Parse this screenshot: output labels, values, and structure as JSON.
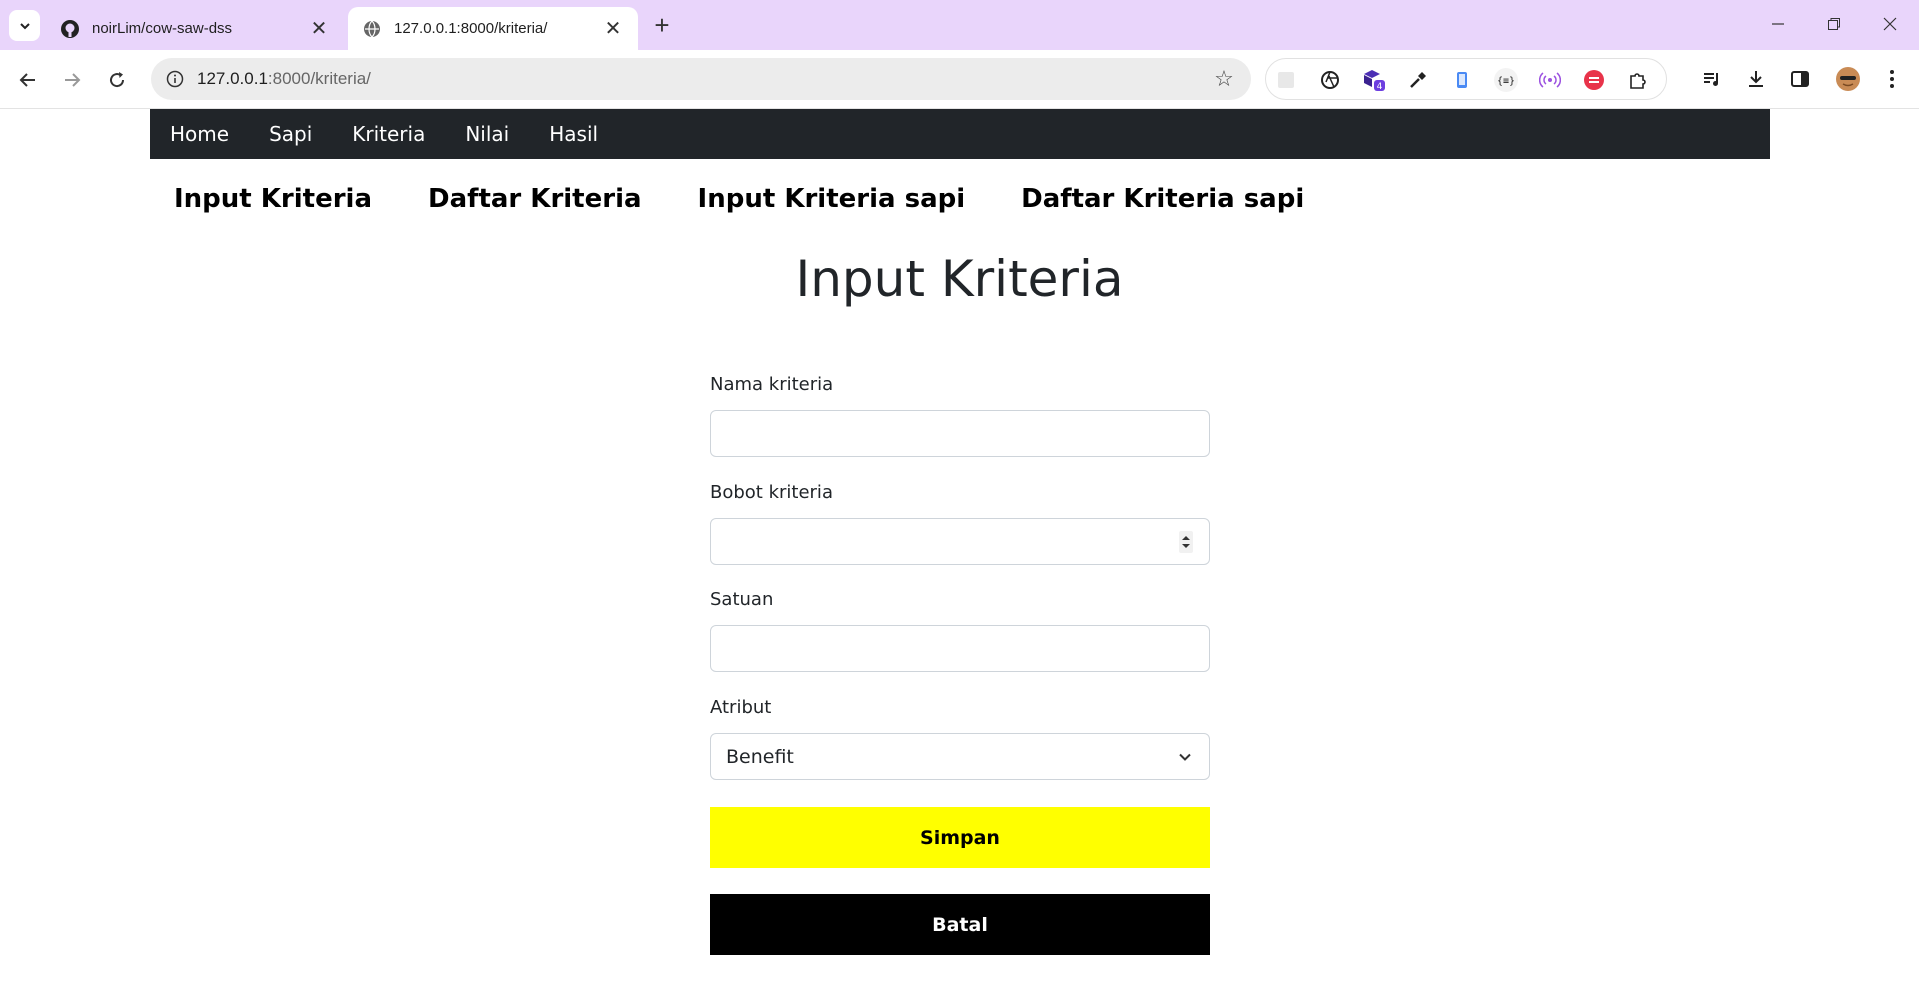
{
  "browser": {
    "tabs": [
      {
        "title": "noirLim/cow-saw-dss",
        "favicon": "github-icon",
        "active": false
      },
      {
        "title": "127.0.0.1:8000/kriteria/",
        "favicon": "globe-icon",
        "active": true
      }
    ],
    "new_tab_symbol": "+",
    "url_host": "127.0.0.1",
    "url_path": ":8000/kriteria/",
    "extension_badge": "4",
    "colors": {
      "tabbar": "#e9d5fb",
      "omnibox": "#ececec"
    }
  },
  "site_nav": {
    "items": [
      "Home",
      "Sapi",
      "Kriteria",
      "Nilai",
      "Hasil"
    ],
    "background": "#212529"
  },
  "subnav": {
    "items": [
      "Input Kriteria",
      "Daftar Kriteria",
      "Input Kriteria sapi",
      "Daftar Kriteria sapi"
    ]
  },
  "page": {
    "title": "Input Kriteria"
  },
  "form": {
    "nama_label": "Nama kriteria",
    "nama_value": "",
    "bobot_label": "Bobot kriteria",
    "bobot_value": "",
    "satuan_label": "Satuan",
    "satuan_value": "",
    "atribut_label": "Atribut",
    "atribut_value": "Benefit",
    "save_label": "Simpan",
    "cancel_label": "Batal",
    "save_color": "#ffff00",
    "cancel_color": "#000000"
  }
}
